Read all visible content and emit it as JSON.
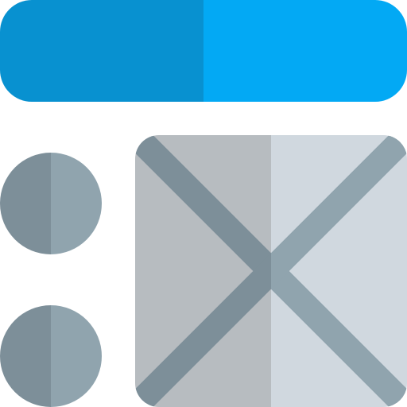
{
  "icon": {
    "name": "layout-wireframe-icon",
    "parts": {
      "header_bar": "header-bar-icon",
      "bullet_1": "bullet-circle-icon",
      "bullet_2": "bullet-circle-icon",
      "image_placeholder": "image-placeholder-icon"
    }
  },
  "colors": {
    "header_left": "#0891D0",
    "header_right": "#03A9F4",
    "gray_dark": "#7D8F99",
    "gray_light": "#90A4AE",
    "panel_left": "#B7BCC0",
    "panel_right": "#D0D8DF"
  }
}
